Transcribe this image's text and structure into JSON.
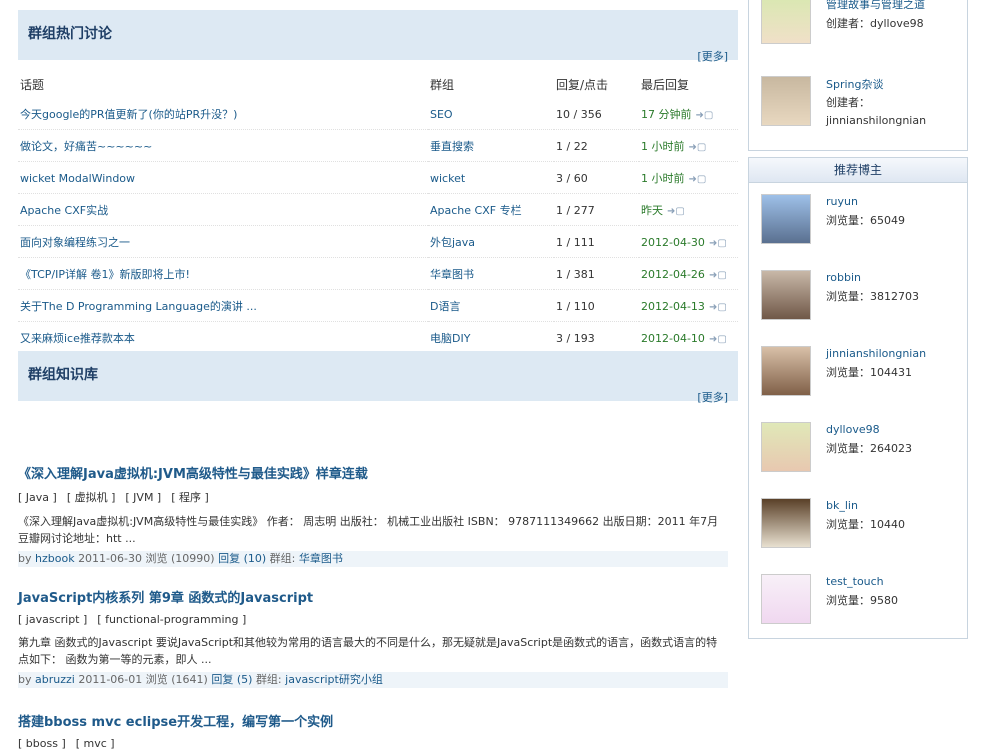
{
  "hot": {
    "title": "群组热门讨论",
    "more": "[更多]",
    "headers": [
      "话题",
      "群组",
      "回复/点击",
      "最后回复"
    ],
    "rows": [
      {
        "topic": "今天google的PR值更新了(你的站PR升没？)",
        "group": "SEO",
        "counts": "10 / 356",
        "last": "17 分钟前"
      },
      {
        "topic": "做论文，好痛苦~~~~~~",
        "group": "垂直搜索",
        "counts": "1 / 22",
        "last": "1 小时前"
      },
      {
        "topic": "wicket ModalWindow",
        "group": "wicket",
        "counts": "3 / 60",
        "last": "1 小时前"
      },
      {
        "topic": "Apache CXF实战",
        "group": "Apache CXF 专栏",
        "counts": "1 / 277",
        "last": "昨天"
      },
      {
        "topic": "面向对象编程练习之一",
        "group": "外包java",
        "counts": "1 / 111",
        "last": "2012-04-30"
      },
      {
        "topic": "《TCP/IP详解 卷1》新版即将上市!",
        "group": "华章图书",
        "counts": "1 / 381",
        "last": "2012-04-26"
      },
      {
        "topic": "关于The D Programming Language的演讲 ...",
        "group": "D语言",
        "counts": "1 / 110",
        "last": "2012-04-13"
      },
      {
        "topic": "又来麻烦ice推荐款本本",
        "group": "电脑DIY",
        "counts": "3 / 193",
        "last": "2012-04-10"
      }
    ]
  },
  "knowledge": {
    "title": "群组知识库",
    "more": "[更多]",
    "articles": [
      {
        "title": "《深入理解Java虚拟机:JVM高级特性与最佳实践》样章连载",
        "tags": [
          "[ Java ]",
          "[ 虚拟机 ]",
          "[ JVM ]",
          "[ 程序 ]"
        ],
        "desc": "《深入理解Java虚拟机:JVM高级特性与最佳实践》 作者： 周志明 出版社： 机械工业出版社 ISBN： 9787111349662 出版日期：2011 年7月 豆瓣网讨论地址：htt ...",
        "by": "by",
        "author": "hzbook",
        "date": "2011-06-30 浏览",
        "views": "(10990)",
        "reply": "回复",
        "replies": "(10)",
        "group_label": "群组:",
        "group": "华章图书"
      },
      {
        "title": "JavaScript内核系列 第9章 函数式的Javascript",
        "tags": [
          "[ javascript ]",
          "[ functional-programming ]"
        ],
        "desc": "第九章 函数式的Javascript 要说JavaScript和其他较为常用的语言最大的不同是什么，那无疑就是JavaScript是函数式的语言，函数式语言的特点如下： 函数为第一等的元素，即人 ...",
        "by": "by",
        "author": "abruzzi",
        "date": "2011-06-01 浏览",
        "views": "(1641)",
        "reply": "回复",
        "replies": "(5)",
        "group_label": "群组:",
        "group": "javascript研究小组"
      },
      {
        "title": "搭建bboss mvc eclipse开发工程，编写第一个实例",
        "tags": [
          "[ bboss ]",
          "[ mvc ]"
        ]
      }
    ]
  },
  "side": {
    "groups": [
      {
        "name": "管理故事与管理之道",
        "creator_label": "创建者：",
        "creator": "dyllove98"
      },
      {
        "name": "Spring杂谈",
        "creator_label": "创建者：",
        "creator": "jinnianshilongnian"
      }
    ],
    "rec_title": "推荐博主",
    "bloggers": [
      {
        "name": "ruyun",
        "views": "浏览量：65049",
        "avatar": "penguin"
      },
      {
        "name": "robbin",
        "views": "浏览量：3812703",
        "avatar": "man"
      },
      {
        "name": "jinnianshilongnian",
        "views": "浏览量：104431",
        "avatar": "man2"
      },
      {
        "name": "dyllove98",
        "views": "浏览量：264023",
        "avatar": "girl"
      },
      {
        "name": "bk_lin",
        "views": "浏览量：10440",
        "avatar": "rabbit"
      },
      {
        "name": "test_touch",
        "views": "浏览量：9580",
        "avatar": "pink"
      }
    ]
  }
}
